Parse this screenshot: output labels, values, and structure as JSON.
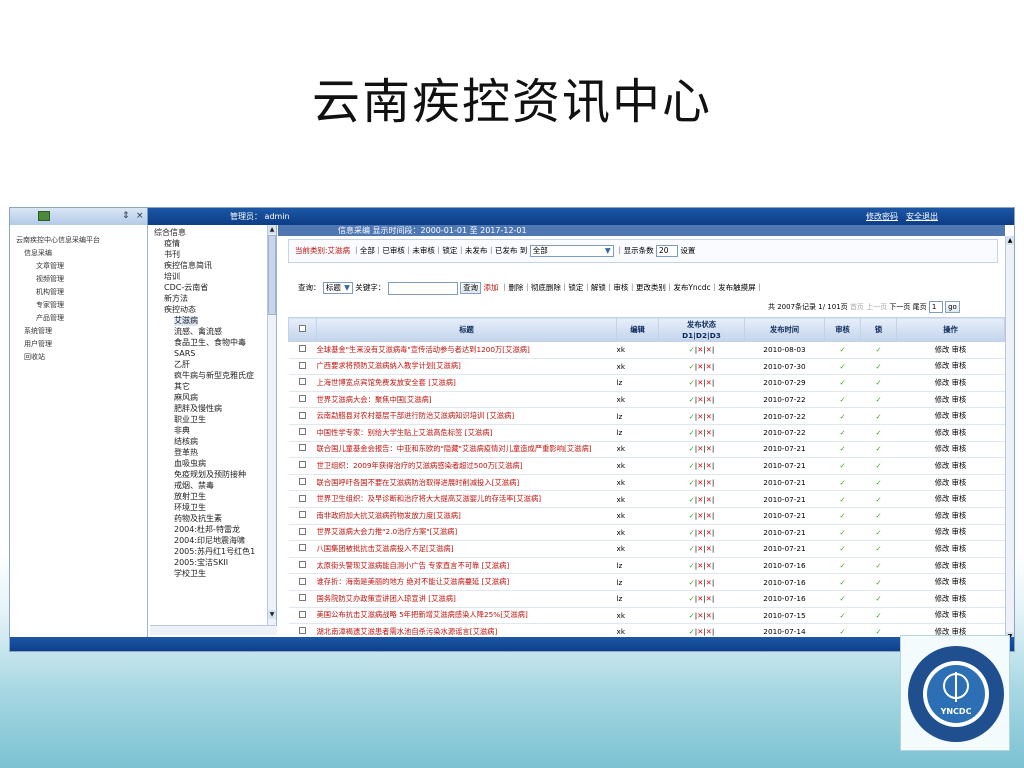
{
  "slide": {
    "title": "云南疾控资讯中心"
  },
  "topbar": {
    "ctl_a": "⇕",
    "ctl_b": "×",
    "admin_label": "管理员： admin",
    "link_pwd": "修改密码",
    "link_logout": "安全退出"
  },
  "leftnav": {
    "items": [
      "云南疾控中心信息采编平台",
      "信息采编",
      "文章管理",
      "视频管理",
      "机构管理",
      "专家管理",
      "产品管理",
      "系统管理",
      "用户管理",
      "回收站"
    ]
  },
  "tree": {
    "items": [
      "综合信息",
      "疫情",
      "书刊",
      "疾控信息简讯",
      "培训",
      "CDC-云南省",
      "新方法",
      "疾控动态",
      "艾滋病",
      "流感、禽流感",
      "食品卫生、食物中毒",
      "SARS",
      "乙肝",
      "疯牛病与新型克雅氏症",
      "其它",
      "麻风病",
      "肥胖及慢性病",
      "职业卫生",
      "非典",
      "结核病",
      "登革热",
      "血吸虫病",
      "免疫规划及预防接种",
      "戒烟、禁毒",
      "放射卫生",
      "环境卫生",
      "药物及抗生素",
      "2004:杜邦-特雷龙",
      "2004:印尼地震海啸",
      "2005:苏丹红1号红色1",
      "2005:宝洁SKII",
      "学校卫生"
    ]
  },
  "main": {
    "header": "信息采编 显示时间段：2000-01-01 至 2017-12-01",
    "filter1": {
      "cur_label": "当前类别:艾滋病",
      "links": "｜全部｜已审核｜未审核｜锁定｜未发布｜已发布 到",
      "status_value": "全部",
      "count_label": "｜显示条数",
      "count_value": "20",
      "set_label": "设置"
    },
    "filter2": {
      "query_label": "查询：",
      "field_value": "标题",
      "keyword_label": "关键字：",
      "query_btn": "查询",
      "add_link": "添加",
      "actions": "｜删除｜彻底删除｜锁定｜解锁｜审核｜更改类别｜发布Yncdc｜发布触摸屏｜"
    },
    "pager": {
      "total": "共 2007条记录 1/ 101页",
      "first": "首页",
      "prev": "上一页",
      "next": "下一页",
      "last": "尾页",
      "page_value": "1",
      "go": "go"
    },
    "columns": {
      "title": "标题",
      "editor": "编辑",
      "status": "发布状态",
      "status2": "D1|D2|D3",
      "time": "发布时间",
      "audit": "审核",
      "lock": "锁",
      "op": "操作"
    },
    "status_marks": {
      "ok": "✓",
      "no": "✕",
      "sep": "|"
    },
    "op_text": "修改 审核",
    "rows": [
      {
        "title": "全球基金\"生来没有艾滋病毒\"宣传活动参与者达到1200万[艾滋病]",
        "editor": "xk",
        "time": "2010-08-03"
      },
      {
        "title": "广西要求将预防艾滋病纳入教学计划[艾滋病]",
        "editor": "xk",
        "time": "2010-07-30"
      },
      {
        "title": "上海世博宽点宾馆免费发放安全套 [艾滋病]",
        "editor": "lz",
        "time": "2010-07-29"
      },
      {
        "title": "世界艾滋病大会：聚焦中国[艾滋病]",
        "editor": "xk",
        "time": "2010-07-22"
      },
      {
        "title": "云南勐腊县对农村基层干部进行防治艾滋病知识培训 [艾滋病]",
        "editor": "lz",
        "time": "2010-07-22"
      },
      {
        "title": "中国性学专家：别给大学生贴上艾滋高危标签 [艾滋病]",
        "editor": "lz",
        "time": "2010-07-22"
      },
      {
        "title": "联合国儿童基金会报告：中亚和东欧的\"隐藏\"艾滋病疫情对儿童造成严重影响[艾滋病]",
        "editor": "xk",
        "time": "2010-07-21"
      },
      {
        "title": "世卫组织：2009年获得治疗的艾滋病感染者超过500万[艾滋病]",
        "editor": "xk",
        "time": "2010-07-21"
      },
      {
        "title": "联合国呼吁各国不要在艾滋病防治取得进展时削减投入[艾滋病]",
        "editor": "xk",
        "time": "2010-07-21"
      },
      {
        "title": "世界卫生组织：及早诊断和治疗将大大提高艾滋婴儿的存活率[艾滋病]",
        "editor": "xk",
        "time": "2010-07-21"
      },
      {
        "title": "南非政府加大抗艾滋病药物发放力度[艾滋病]",
        "editor": "xk",
        "time": "2010-07-21"
      },
      {
        "title": "世界艾滋病大会力推\"2.0治疗方案\"[艾滋病]",
        "editor": "xk",
        "time": "2010-07-21"
      },
      {
        "title": "八国集团被批抗击艾滋病投入不足[艾滋病]",
        "editor": "xk",
        "time": "2010-07-21"
      },
      {
        "title": "太原街头警现艾滋病能自测小广告 专家直言不可靠 [艾滋病]",
        "editor": "lz",
        "time": "2010-07-16"
      },
      {
        "title": "谁存折：海南是美丽的地方 绝对不能让艾滋病蔓延 [艾滋病]",
        "editor": "lz",
        "time": "2010-07-16"
      },
      {
        "title": "国务院防艾办政策宣讲团入琼宣讲 [艾滋病]",
        "editor": "lz",
        "time": "2010-07-16"
      },
      {
        "title": "美国公布抗击艾滋病战略 5年把新增艾滋病感染人降25%[艾滋病]",
        "editor": "xk",
        "time": "2010-07-15"
      },
      {
        "title": "湖北南漳褐遗艾滋患者需水池自杀污染水源谣言[艾滋病]",
        "editor": "xk",
        "time": "2010-07-14"
      }
    ]
  },
  "logo": {
    "text": "YNCDC"
  }
}
